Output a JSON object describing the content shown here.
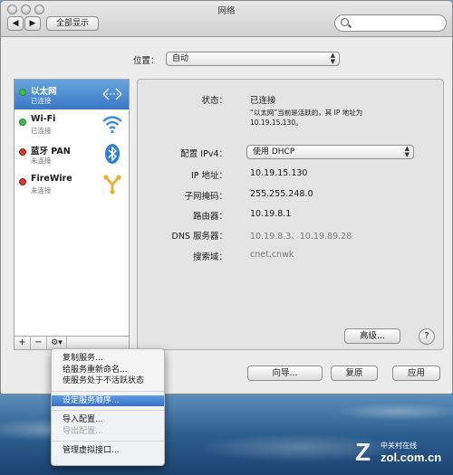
{
  "window": {
    "title": "网络"
  },
  "toolbar": {
    "show_all_label": "全部显示",
    "back_arrow": "◀",
    "forward_arrow": "▶",
    "search_placeholder": ""
  },
  "location": {
    "label": "位置：",
    "value": "自动"
  },
  "services": [
    {
      "name": "以太网",
      "status": "已连接",
      "status_color": "#3fbf3f",
      "icon": "ethernet-arrows-icon",
      "selected": true
    },
    {
      "name": "Wi-Fi",
      "status": "已连接",
      "status_color": "#3fbf3f",
      "icon": "wifi-icon",
      "selected": false
    },
    {
      "name": "蓝牙 PAN",
      "status": "未连接",
      "status_color": "#d23a2d",
      "icon": "bluetooth-icon",
      "selected": false
    },
    {
      "name": "FireWire",
      "status": "未连接",
      "status_color": "#d23a2d",
      "icon": "firewire-icon",
      "selected": false
    }
  ],
  "sidebar_toolbar": {
    "add": "+",
    "remove": "−",
    "gear": "⚙▾"
  },
  "detail": {
    "status_label": "状态：",
    "status_value": "已连接",
    "status_desc_line1": "“以太网”当前是活跃的，其 IP 地址为",
    "status_desc_line2": "10.19.15.130。",
    "config_label": "配置 IPv4：",
    "config_value": "使用 DHCP",
    "ip_label": "IP 地址：",
    "ip_value": "10.19.15.130",
    "subnet_label": "子网掩码：",
    "subnet_value": "255.255.248.0",
    "router_label": "路由器：",
    "router_value": "10.19.8.1",
    "dns_label": "DNS 服务器：",
    "dns_value": "10.19.8.3、10.19.89.28",
    "search_domain_label": "搜索域：",
    "search_domain_value": "cnet.cnwk",
    "advanced_label": "高级...",
    "help_label": "?"
  },
  "footer": {
    "assist_label": "向导...",
    "revert_label": "复原",
    "apply_label": "应用"
  },
  "context_menu": {
    "items": [
      {
        "label": "复制服务...",
        "state": "normal"
      },
      {
        "label": "给服务重新命名...",
        "state": "normal"
      },
      {
        "label": "使服务处于不活跃状态",
        "state": "normal"
      },
      {
        "label": "设定服务顺序...",
        "state": "highlighted"
      },
      {
        "label": "导入配置...",
        "state": "normal"
      },
      {
        "label": "导出配置...",
        "state": "disabled"
      },
      {
        "label": "管理虚拟接口...",
        "state": "normal"
      }
    ]
  },
  "watermark": {
    "mark": "Z",
    "cn": "中关村在线",
    "en": "zol.com.cn"
  },
  "colors": {
    "selection": "#3a78c6",
    "connected": "#3fbf3f",
    "disconnected": "#d23a2d"
  }
}
